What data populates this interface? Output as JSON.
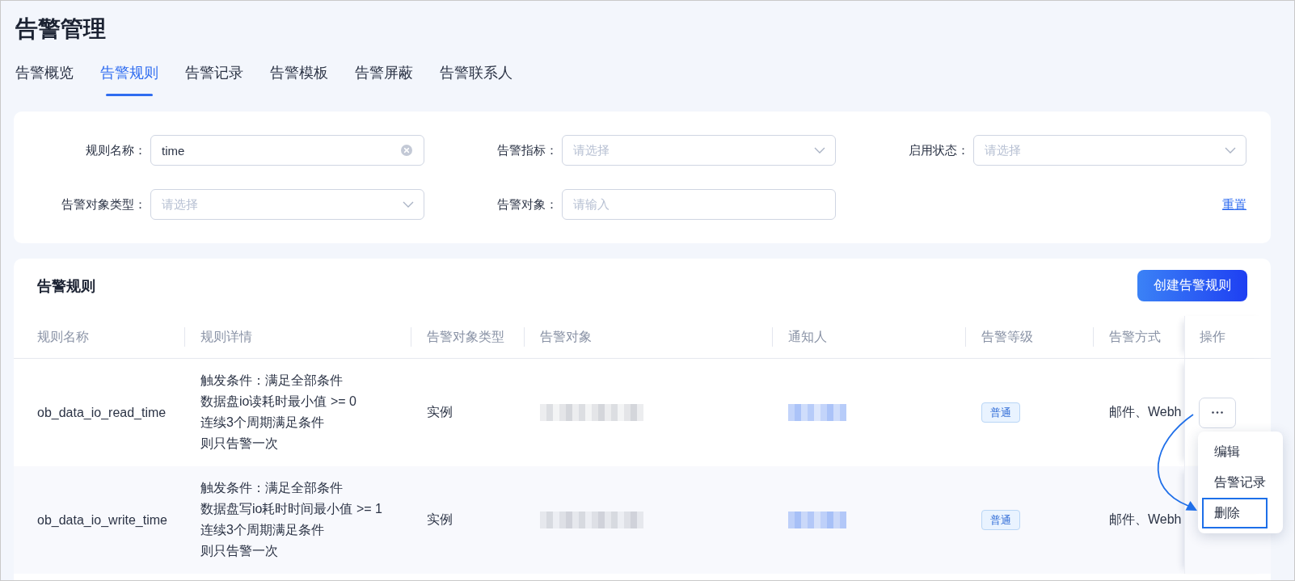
{
  "title": "告警管理",
  "tabs": [
    {
      "label": "告警概览",
      "selected": false
    },
    {
      "label": "告警规则",
      "selected": true
    },
    {
      "label": "告警记录",
      "selected": false
    },
    {
      "label": "告警模板",
      "selected": false
    },
    {
      "label": "告警屏蔽",
      "selected": false
    },
    {
      "label": "告警联系人",
      "selected": false
    }
  ],
  "filter_panel": {
    "fields": [
      {
        "label": "规则名称：",
        "kind": "text",
        "value": "time",
        "clearable": true
      },
      {
        "label": "告警指标：",
        "kind": "select",
        "placeholder": "请选择"
      },
      {
        "label": "启用状态：",
        "kind": "select",
        "placeholder": "请选择"
      },
      {
        "label": "告警对象类型：",
        "kind": "select",
        "placeholder": "请选择"
      },
      {
        "label": "告警对象：",
        "kind": "text",
        "placeholder": "请输入"
      }
    ],
    "reset_link": "重置"
  },
  "rules_panel": {
    "title": "告警规则",
    "create_button": "创建告警规则",
    "columns": [
      "规则名称",
      "规则详情",
      "告警对象类型",
      "告警对象",
      "通知人",
      "告警等级",
      "告警方式",
      "操作"
    ],
    "rows": [
      {
        "name": "ob_data_io_read_time",
        "details": [
          "触发条件：满足全部条件",
          "数据盘io读耗时最小值 >= 0",
          "连续3个周期满足条件",
          "则只告警一次"
        ],
        "object_type": "实例",
        "target": {
          "blurred": true
        },
        "notifier": {
          "blurred": true
        },
        "level": "普通",
        "methods": "邮件、Webh",
        "more_button": true,
        "menu": {
          "items": [
            {
              "label": "编辑",
              "highlighted": false
            },
            {
              "label": "告警记录",
              "highlighted": false
            },
            {
              "label": "删除",
              "highlighted": true
            }
          ],
          "pointer_arrow": true
        }
      },
      {
        "name": "ob_data_io_write_time",
        "details": [
          "触发条件：满足全部条件",
          "数据盘写io耗时时间最小值 >= 1",
          "连续3个周期满足条件",
          "则只告警一次"
        ],
        "object_type": "实例",
        "target": {
          "blurred": true
        },
        "notifier": {
          "blurred": true
        },
        "level": "普通",
        "methods": "邮件、Webh",
        "more_button": false
      }
    ]
  }
}
